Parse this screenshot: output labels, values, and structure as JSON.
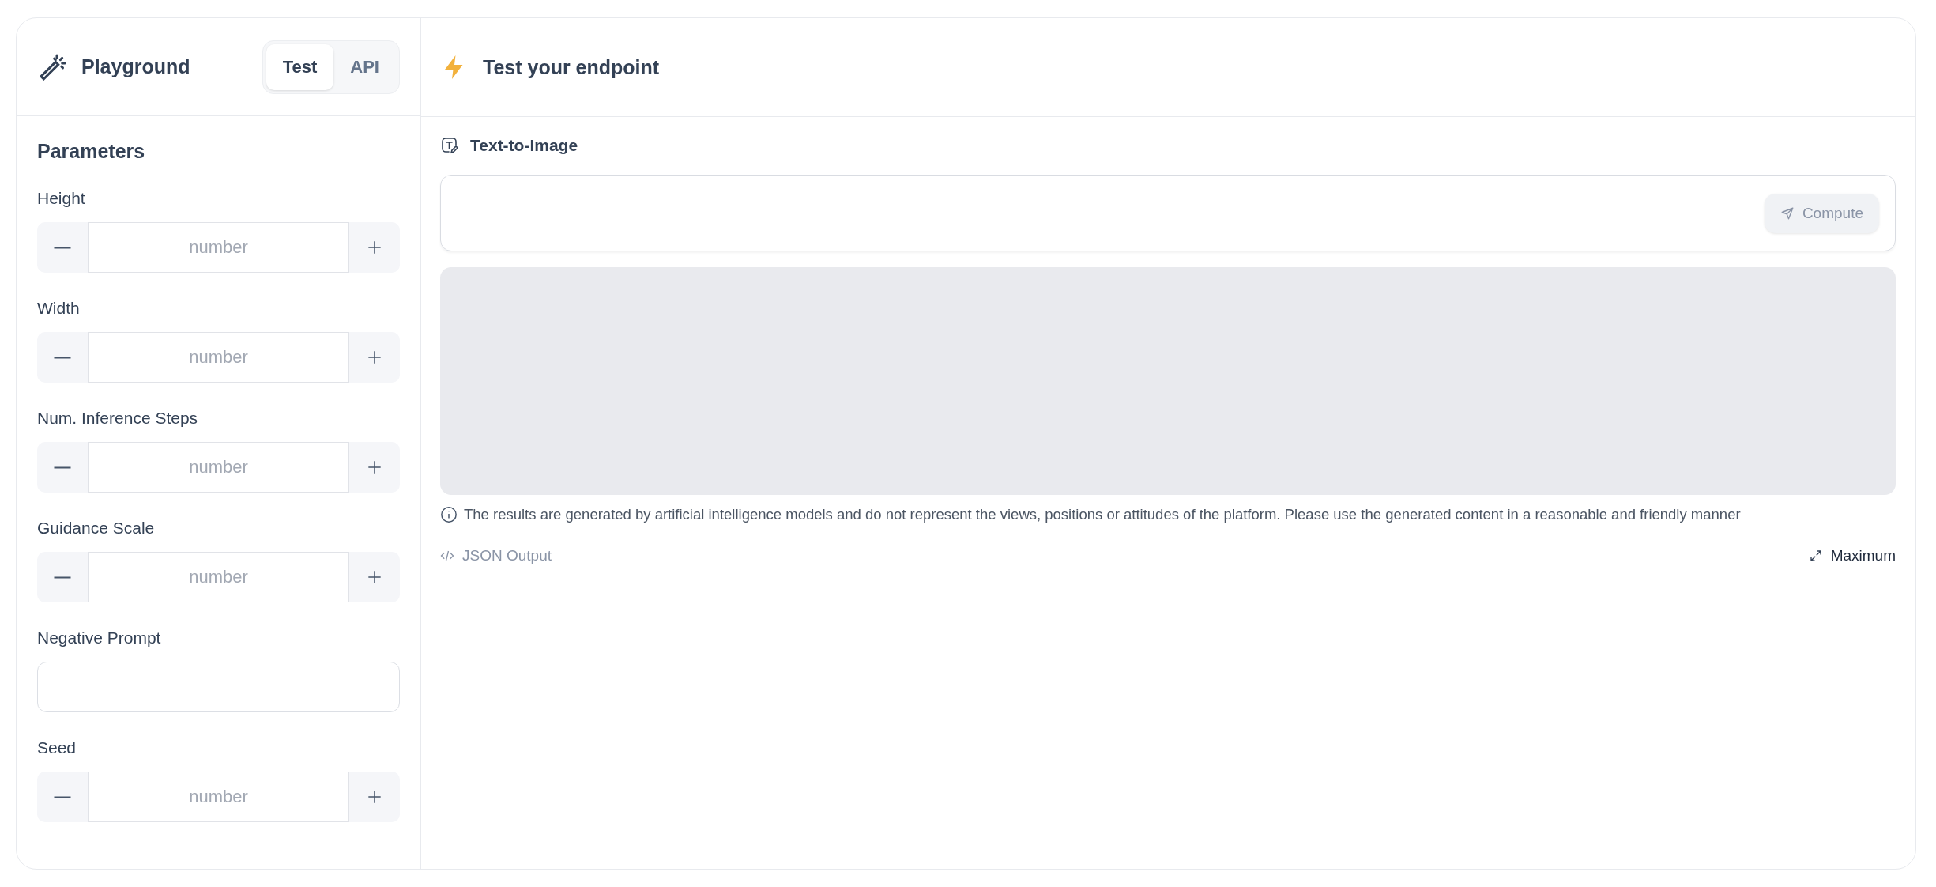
{
  "sidebar": {
    "title": "Playground",
    "tabs": [
      {
        "label": "Test",
        "selected": true
      },
      {
        "label": "API",
        "selected": false
      }
    ],
    "section_title": "Parameters",
    "parameters": [
      {
        "label": "Height",
        "kind": "stepper",
        "placeholder": "number"
      },
      {
        "label": "Width",
        "kind": "stepper",
        "placeholder": "number"
      },
      {
        "label": "Num. Inference Steps",
        "kind": "stepper",
        "placeholder": "number"
      },
      {
        "label": "Guidance Scale",
        "kind": "stepper",
        "placeholder": "number"
      },
      {
        "label": "Negative Prompt",
        "kind": "text"
      },
      {
        "label": "Seed",
        "kind": "stepper",
        "placeholder": "number"
      }
    ]
  },
  "main": {
    "title": "Test your endpoint",
    "task": "Text-to-Image",
    "compute_button": "Compute",
    "disclaimer": "The results are generated by artificial intelligence models and do not represent the views, positions or attitudes of the platform. Please use the generated content in a reasonable and friendly manner",
    "json_output": "JSON Output",
    "maximize": "Maximum"
  }
}
